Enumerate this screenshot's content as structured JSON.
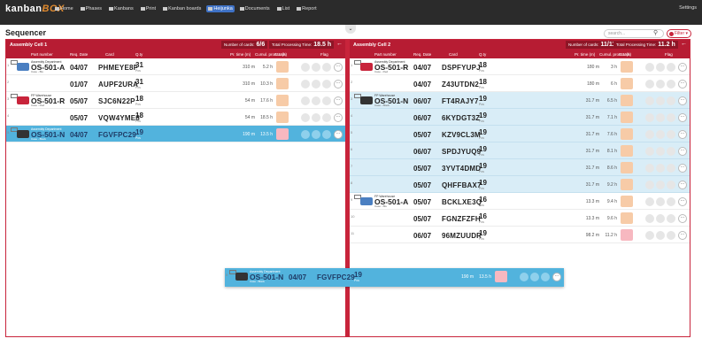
{
  "app": {
    "logo_main": "kanban",
    "logo_box": "BOX",
    "nav": [
      "Home",
      "Phases",
      "Kanbans",
      "Print",
      "Kanban boards",
      "Heijunka",
      "Documents",
      "List",
      "Report"
    ],
    "nav_active_index": 5,
    "settings": "Settings"
  },
  "page": {
    "title": "Sequencer",
    "search_placeholder": "search...",
    "filter_label": "Filter",
    "collapse_icon": "chevron-down-icon"
  },
  "columns": {
    "part": "Part number",
    "date": "Req. Date",
    "card": "Card",
    "qty": "Q.ty",
    "ptime": "Pr. time (m)",
    "cumul": "Cumul. proc. t. (h)",
    "status": "Status",
    "flag": "Flag"
  },
  "cells": [
    {
      "name": "Assembly Cell 1",
      "cards_label": "Number of cards:",
      "cards_value": "6/6",
      "total_label": "Total Processing Time:",
      "total_value": "18.5 h",
      "rows": [
        {
          "idx": "1",
          "dept": "Assembly Department",
          "part": "OS-501-A",
          "sub": "Case - Blu",
          "date": "04/07",
          "card": "PHMEYE8F",
          "qty": "31",
          "pcs": "Pcs",
          "ptime": "310 m",
          "cumul": "5.2 h",
          "style": "white",
          "thumb": "#4a7fc1",
          "status": "#f7cba7"
        },
        {
          "idx": "2",
          "dept": "",
          "part": "",
          "sub": "",
          "date": "01/07",
          "card": "AUPF2URA",
          "qty": "31",
          "pcs": "Pcs",
          "ptime": "310 m",
          "cumul": "10.3 h",
          "style": "white",
          "thumb": "",
          "status": "#f7cba7"
        },
        {
          "idx": "3",
          "dept": "FP Warehouse",
          "part": "OS-501-R",
          "sub": "Case - Red",
          "date": "05/07",
          "card": "SJC6N22P",
          "qty": "18",
          "pcs": "Pcs",
          "ptime": "54 m",
          "cumul": "17.6 h",
          "style": "white",
          "thumb": "#c8243b",
          "status": "#f7cba7"
        },
        {
          "idx": "4",
          "dept": "",
          "part": "",
          "sub": "",
          "date": "05/07",
          "card": "VQW4YME8",
          "qty": "18",
          "pcs": "Pcs",
          "ptime": "54 m",
          "cumul": "18.5 h",
          "style": "white",
          "thumb": "",
          "status": "#f7cba7"
        },
        {
          "idx": "5",
          "dept": "Assembly Department",
          "part": "OS-501-N",
          "sub": "Case - Black",
          "date": "04/07",
          "card": "FGVFPC29",
          "qty": "19",
          "pcs": "Pcs",
          "ptime": "190 m",
          "cumul": "13.5 h",
          "style": "blue-strong",
          "thumb": "#333",
          "status": "#f7b8c0"
        }
      ]
    },
    {
      "name": "Assembly Cell 2",
      "cards_label": "Number of cards:",
      "cards_value": "11/11",
      "total_label": "Total Processing Time:",
      "total_value": "11.2 h",
      "rows": [
        {
          "idx": "1",
          "dept": "Assembly Department",
          "part": "OS-501-R",
          "sub": "Case - Red",
          "date": "04/07",
          "card": "DSPFYUPJ",
          "qty": "18",
          "pcs": "Pcs",
          "ptime": "180 m",
          "cumul": "3 h",
          "style": "white",
          "thumb": "#c8243b",
          "status": "#f7cba7"
        },
        {
          "idx": "2",
          "dept": "",
          "part": "",
          "sub": "",
          "date": "04/07",
          "card": "Z43UTDN2",
          "qty": "18",
          "pcs": "Pcs",
          "ptime": "180 m",
          "cumul": "6 h",
          "style": "white",
          "thumb": "",
          "status": "#f7cba7"
        },
        {
          "idx": "3",
          "dept": "FP Warehouse",
          "part": "OS-501-N",
          "sub": "Case - Black",
          "date": "06/07",
          "card": "FT4RAJY7",
          "qty": "19",
          "pcs": "Pcs",
          "ptime": "31.7 m",
          "cumul": "6.5 h",
          "style": "blue-light",
          "thumb": "#333",
          "status": "#f7cba7"
        },
        {
          "idx": "4",
          "dept": "",
          "part": "",
          "sub": "",
          "date": "06/07",
          "card": "6KYDGT3Z",
          "qty": "19",
          "pcs": "Pcs",
          "ptime": "31.7 m",
          "cumul": "7.1 h",
          "style": "blue-light",
          "thumb": "",
          "status": "#f7cba7"
        },
        {
          "idx": "5",
          "dept": "",
          "part": "",
          "sub": "",
          "date": "05/07",
          "card": "KZV9CL3M",
          "qty": "19",
          "pcs": "Pcs",
          "ptime": "31.7 m",
          "cumul": "7.6 h",
          "style": "blue-light",
          "thumb": "",
          "status": "#f7cba7"
        },
        {
          "idx": "6",
          "dept": "",
          "part": "",
          "sub": "",
          "date": "06/07",
          "card": "SPDJYUQ9",
          "qty": "19",
          "pcs": "Pcs",
          "ptime": "31.7 m",
          "cumul": "8.1 h",
          "style": "blue-light",
          "thumb": "",
          "status": "#f7cba7"
        },
        {
          "idx": "7",
          "dept": "",
          "part": "",
          "sub": "",
          "date": "05/07",
          "card": "3YVT4DMD",
          "qty": "19",
          "pcs": "Pcs",
          "ptime": "31.7 m",
          "cumul": "8.6 h",
          "style": "blue-light",
          "thumb": "",
          "status": "#f7cba7"
        },
        {
          "idx": "8",
          "dept": "",
          "part": "",
          "sub": "",
          "date": "05/07",
          "card": "QHFFBAX7",
          "qty": "19",
          "pcs": "Pcs",
          "ptime": "31.7 m",
          "cumul": "9.2 h",
          "style": "blue-light",
          "thumb": "",
          "status": "#f7cba7"
        },
        {
          "idx": "9",
          "dept": "FP Warehouse",
          "part": "OS-501-A",
          "sub": "Case - Blu",
          "date": "05/07",
          "card": "BCKLXE3Q",
          "qty": "16",
          "pcs": "Pcs",
          "ptime": "13.3 m",
          "cumul": "9.4 h",
          "style": "white",
          "thumb": "#4a7fc1",
          "status": "#f7cba7"
        },
        {
          "idx": "10",
          "dept": "",
          "part": "",
          "sub": "",
          "date": "05/07",
          "card": "FGNZFZFH",
          "qty": "16",
          "pcs": "Pcs",
          "ptime": "13.3 m",
          "cumul": "9.6 h",
          "style": "white",
          "thumb": "",
          "status": "#f7cba7"
        },
        {
          "idx": "11",
          "dept": "",
          "part": "",
          "sub": "",
          "date": "06/07",
          "card": "96MZUUDR",
          "qty": "19",
          "pcs": "Pcs",
          "ptime": "98.2 m",
          "cumul": "11.2 h",
          "style": "white",
          "thumb": "",
          "status": "#f7b8c0"
        }
      ]
    }
  ],
  "drag_preview": {
    "idx": "5",
    "dept": "Assembly Department",
    "part": "OS-501-N",
    "sub": "Case - Black",
    "date": "04/07",
    "card": "FGVFPC29",
    "qty": "19",
    "pcs": "Pcs",
    "ptime": "190 m",
    "cumul": "13.5 h",
    "style": "blue-strong",
    "thumb": "#333",
    "status": "#f7b8c0"
  },
  "colors": {
    "accent": "#b71c33",
    "selected": "#52b3dd",
    "highlight": "#d9edf7",
    "nav_active": "#3f72c6"
  }
}
